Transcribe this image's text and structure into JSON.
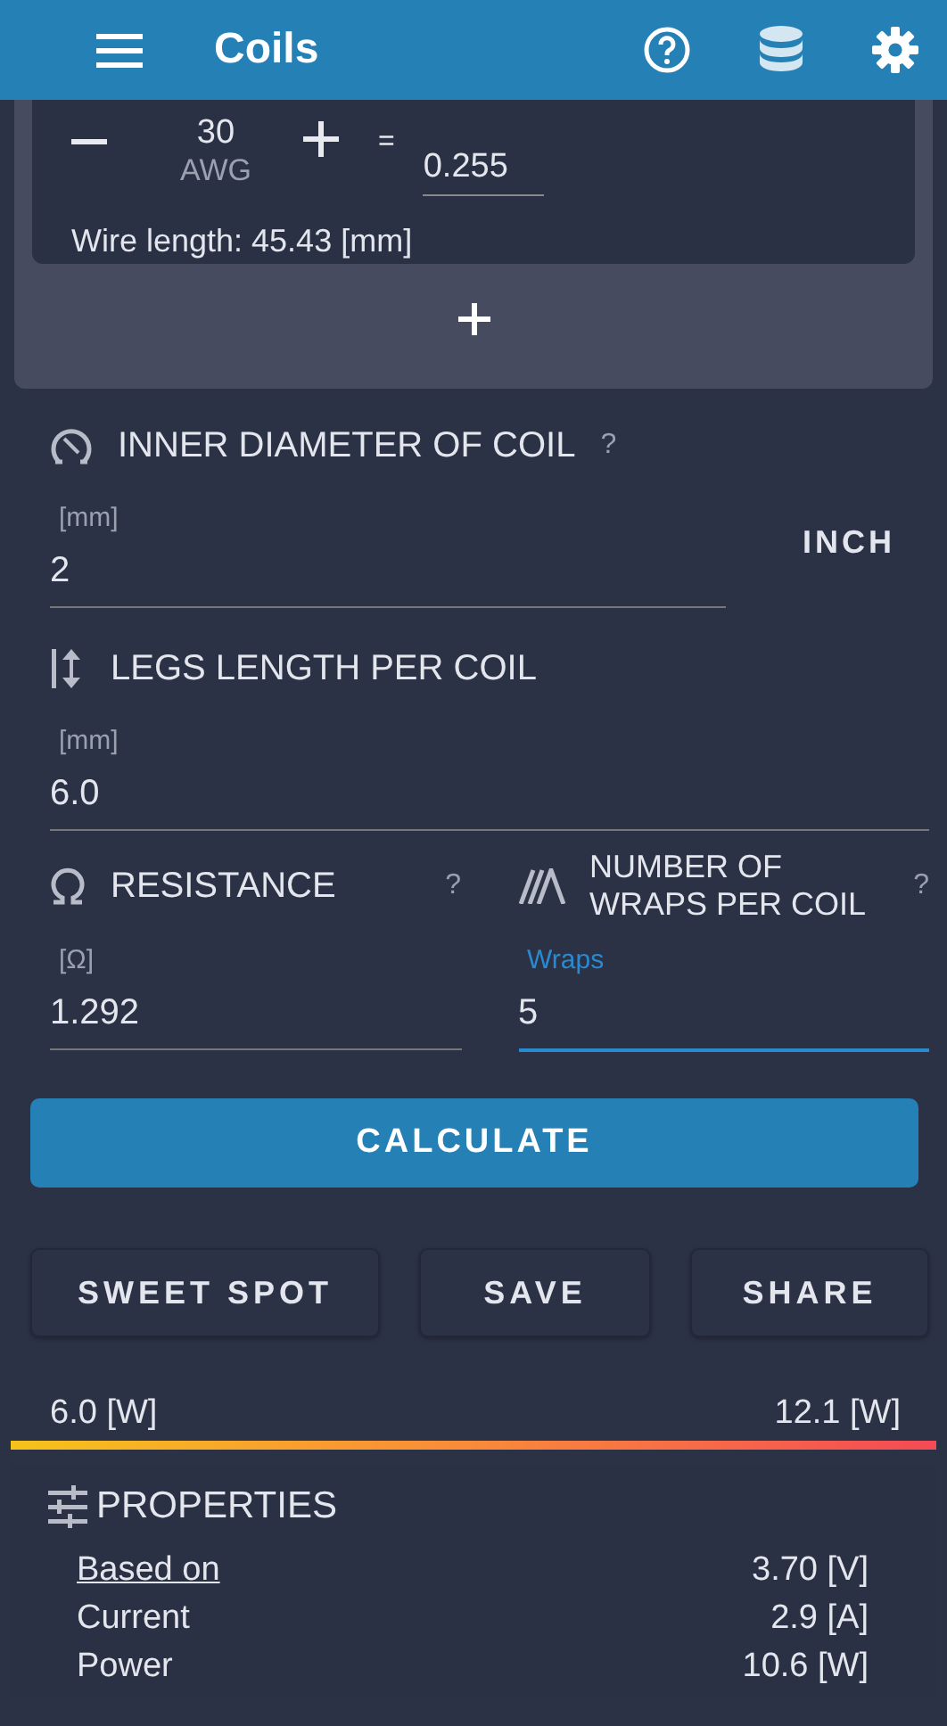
{
  "app_bar": {
    "title": "Coils"
  },
  "wire": {
    "gauge": "30",
    "gauge_unit": "AWG",
    "equals": "=",
    "diameter": "0.255",
    "wire_length": "Wire length: 45.43 [mm]"
  },
  "inner_diameter": {
    "title": "INNER DIAMETER OF COIL",
    "help": "?",
    "unit": "[mm]",
    "value": "2",
    "unit_button": "INCH"
  },
  "legs": {
    "title": "LEGS LENGTH PER COIL",
    "unit": "[mm]",
    "value": "6.0"
  },
  "resistance": {
    "title": "RESISTANCE",
    "help": "?",
    "unit": "[Ω]",
    "value": "1.292",
    "focused": false
  },
  "wraps": {
    "title": "NUMBER OF WRAPS PER COIL",
    "help": "?",
    "unit": "Wraps",
    "value": "5",
    "focused": true
  },
  "calculate_button": "CALCULATE",
  "actions": [
    "SWEET SPOT",
    "SAVE",
    "SHARE"
  ],
  "power_range": {
    "min": "6.0 [W]",
    "max": "12.1 [W]"
  },
  "properties": {
    "title": "PROPERTIES",
    "rows": [
      {
        "label": "Based on",
        "value": "3.70 [V]",
        "link": true
      },
      {
        "label": "Current",
        "value": "2.9 [A]",
        "link": false
      },
      {
        "label": "Power",
        "value": "10.6 [W]",
        "link": false
      }
    ]
  }
}
